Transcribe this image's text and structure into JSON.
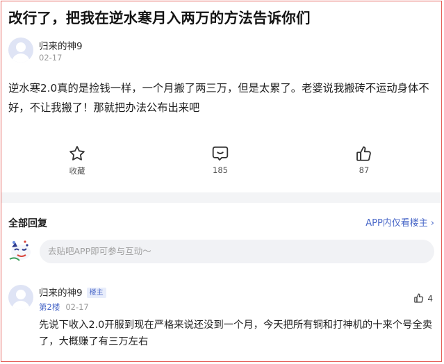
{
  "post": {
    "title": "改行了，把我在逆水寒月入两万的方法告诉你们",
    "author": "归来的神9",
    "date": "02-17",
    "body": "逆水寒2.0真的是捡钱一样，一个月搬了两三万，但是太累了。老婆说我搬砖不运动身体不好，不让我搬了！那就把办法公布出来吧",
    "actions": {
      "favorite_label": "收藏",
      "comment_count": "185",
      "like_count": "87"
    },
    "icons": {
      "favorite": "star-icon",
      "comment": "comment-icon",
      "like": "thumbs-up-icon"
    }
  },
  "replies_section": {
    "title": "全部回复",
    "op_only_link": "APP内仅看楼主",
    "op_only_chevron": "›",
    "reply_placeholder": "去贴吧APP即可参与互动～"
  },
  "replies": [
    {
      "author": "归来的神9",
      "badge": "楼主",
      "floor": "第2楼",
      "date": "02-17",
      "like_count": "4",
      "text": "先说下收入2.0开服到现在严格来说还没到一个月，今天把所有铜和打神机的十来个号全卖了，大概赚了有三万左右"
    }
  ],
  "colors": {
    "accent": "#4a68c8",
    "frame_border": "#e4605a",
    "avatar_bg": "#dfe4f5"
  }
}
